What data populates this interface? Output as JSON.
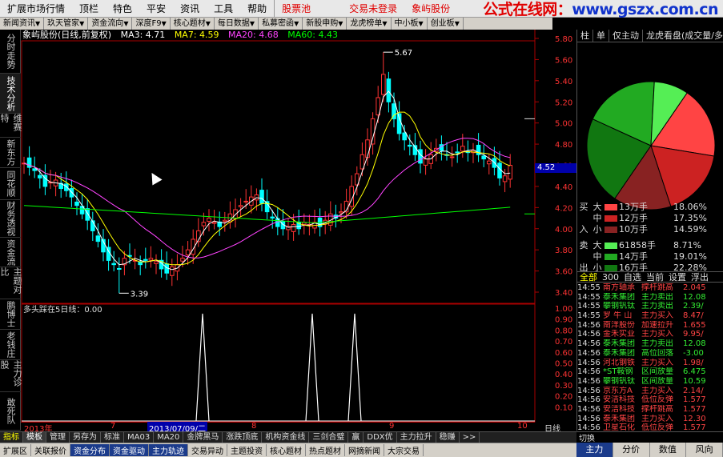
{
  "menubar": {
    "items": [
      "扩展市场行情",
      "顶栏",
      "特色",
      "平安",
      "资讯",
      "工具",
      "帮助"
    ],
    "red_items": [
      "股票池",
      "交易未登录",
      "象屿股份"
    ],
    "watermark_prefix": "公式在线网：",
    "watermark_url": "www.gszx.com.cn"
  },
  "toolbar": {
    "items": [
      "新闻资讯",
      "玖天管家",
      "资金流向",
      "深度F9",
      "核心题材",
      "每日数据",
      "私募密函",
      "新股申购",
      "龙虎榜单",
      "中小板",
      "创业板"
    ]
  },
  "left_tabs": [
    {
      "label": "分时走势"
    },
    {
      "label": "技术分析"
    },
    {
      "label": "维赛特"
    },
    {
      "label": "新东方"
    },
    {
      "label": "同花顺"
    },
    {
      "label": "财务透视"
    },
    {
      "label": "资金流"
    },
    {
      "label": "主题对比"
    },
    {
      "label": "鹏博士"
    },
    {
      "label": "老钱庄"
    },
    {
      "label": "主力诊股"
    },
    {
      "label": "敢死队"
    }
  ],
  "chart_header": {
    "name": "象屿股份(日线,前复权)",
    "ma3": "MA3: 4.71",
    "ma7": "MA7: 4.59",
    "ma20": "MA20: 4.68",
    "ma60": "MA60: 4.43",
    "ma3_color": "#ffffff",
    "ma7_color": "#ffff00",
    "ma20_color": "#ff44ff",
    "ma60_color": "#00ff00"
  },
  "indicator": {
    "label": "多头踩在5日线：0.00"
  },
  "annotations": {
    "high": "5.67",
    "low": "3.39"
  },
  "price_axis": {
    "ticks": [
      "5.80",
      "5.60",
      "5.40",
      "5.20",
      "5.00",
      "4.80",
      "4.60",
      "4.40",
      "4.20",
      "4.00",
      "3.80",
      "3.60",
      "3.40"
    ],
    "current": "4.52"
  },
  "lower_axis": [
    "1.00",
    "0.90",
    "0.80",
    "0.70",
    "0.60",
    "0.50",
    "0.40",
    "0.30",
    "0.20",
    "0.10"
  ],
  "right_panel": {
    "tabs": [
      "柱",
      "单",
      "仅主动",
      "龙虎看盘(成交量/多"
    ],
    "flows": [
      {
        "side": "买",
        "size": "大",
        "color": "#ff4444",
        "amt": "13万手",
        "pct": "18.06%"
      },
      {
        "side": "",
        "size": "中",
        "color": "#cc2222",
        "amt": "12万手",
        "pct": "17.35%"
      },
      {
        "side": "入",
        "size": "小",
        "color": "#882222",
        "amt": "10万手",
        "pct": "14.59%"
      },
      {
        "side": "卖",
        "size": "大",
        "color": "#55ee55",
        "amt": "61858手",
        "pct": "8.71%"
      },
      {
        "side": "",
        "size": "中",
        "color": "#22aa22",
        "amt": "14万手",
        "pct": "19.01%"
      },
      {
        "side": "出",
        "size": "小",
        "color": "#117711",
        "amt": "16万手",
        "pct": "22.28%"
      }
    ],
    "sub_tabs": [
      "全部",
      "300",
      "自选",
      "当前",
      "设置",
      "浮出"
    ],
    "news": [
      {
        "t": "14:55",
        "n": "南方轴承",
        "e": "撑杆跳高",
        "v": "2.045",
        "g": false
      },
      {
        "t": "14:55",
        "n": "泰禾集团",
        "e": "主力卖出",
        "v": "12.08",
        "g": true
      },
      {
        "t": "14:55",
        "n": "攀钢钒钛",
        "e": "主力卖出",
        "v": "2.39/",
        "g": true
      },
      {
        "t": "14:55",
        "n": "罗 牛 山",
        "e": "主力买入",
        "v": "8.47/",
        "g": false
      },
      {
        "t": "14:56",
        "n": "南洋股份",
        "e": "加速拉升",
        "v": "1.655",
        "g": false
      },
      {
        "t": "14:56",
        "n": "金禾实业",
        "e": "主力买入",
        "v": "9.95/",
        "g": false
      },
      {
        "t": "14:56",
        "n": "泰禾集团",
        "e": "主力卖出",
        "v": "12.08",
        "g": true
      },
      {
        "t": "14:56",
        "n": "泰禾集团",
        "e": "高位回落",
        "v": "-3.00",
        "g": true
      },
      {
        "t": "14:56",
        "n": "河北钢铁",
        "e": "主力买入",
        "v": "1.98/",
        "g": false
      },
      {
        "t": "14:56",
        "n": "*ST鞍钢",
        "e": "区间放量",
        "v": "6.475",
        "g": true
      },
      {
        "t": "14:56",
        "n": "攀钢钒钛",
        "e": "区间放量",
        "v": "10.59",
        "g": true
      },
      {
        "t": "14:56",
        "n": "京东方A",
        "e": "主力买入",
        "v": "2.14/",
        "g": false
      },
      {
        "t": "14:56",
        "n": "安洁科技",
        "e": "低位反弹",
        "v": "1.577",
        "g": false
      },
      {
        "t": "14:56",
        "n": "安洁科技",
        "e": "撑杆跳高",
        "v": "1.577",
        "g": false
      },
      {
        "t": "14:56",
        "n": "泰禾集团",
        "e": "主力买入",
        "v": "12.30",
        "g": false
      },
      {
        "t": "14:56",
        "n": "卫星石化",
        "e": "低位反弹",
        "v": "1.577",
        "g": false
      },
      {
        "t": "14:56",
        "n": "高鸿股份",
        "e": "撑杆跳高",
        "v": "1.577",
        "g": false
      }
    ]
  },
  "datebar": {
    "labels": [
      "2013年",
      "7",
      "2013/07/09/二",
      "8",
      "9",
      "10"
    ],
    "period": "日线"
  },
  "bottom_tabs": [
    "指标",
    "模板",
    "管理",
    "另存为",
    "标准",
    "MA03",
    "MA20",
    "金牌黑马",
    "涨跌顶底",
    "机构资金线",
    "三剑合璧",
    "赢",
    "DDX优",
    "主力拉升",
    "稳赚",
    ">>"
  ],
  "statusbar": [
    "扩展区",
    "关联报价",
    "资金分布",
    "资金驱动",
    "主力轨迹",
    "交易异动",
    "主题投资",
    "核心题材",
    "热点题材",
    "网摘新闻",
    "大宗交易"
  ],
  "right_bottom": {
    "top_label": "切换",
    "tabs": [
      "主力",
      "分价",
      "数值",
      "风向"
    ]
  }
}
